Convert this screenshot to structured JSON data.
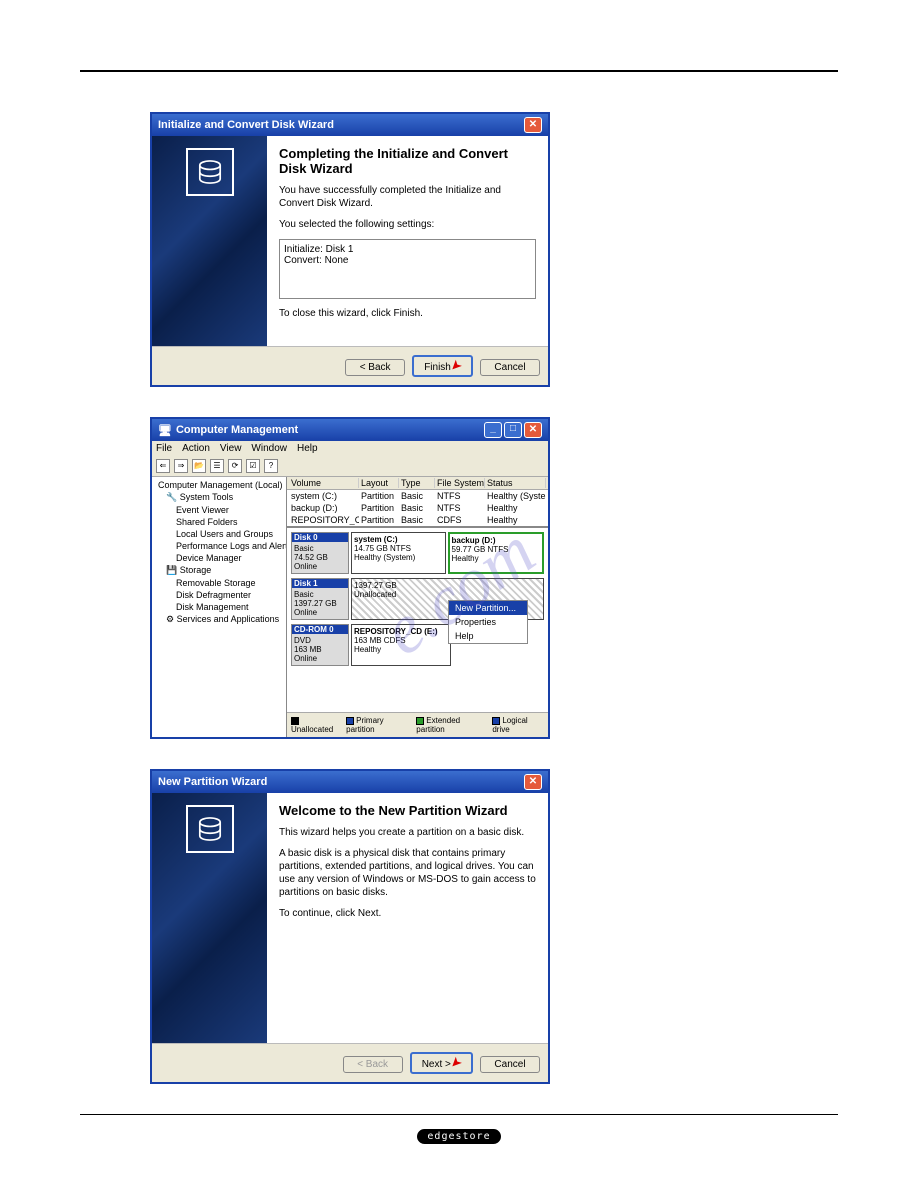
{
  "watermark": "e.com",
  "dialog1": {
    "title": "Initialize and Convert Disk Wizard",
    "heading": "Completing the Initialize and Convert Disk Wizard",
    "body1": "You have successfully completed the Initialize and Convert Disk Wizard.",
    "body2": "You selected the following settings:",
    "settings_line1": "Initialize: Disk 1",
    "settings_line2": "Convert: None",
    "body3": "To close this wizard, click Finish.",
    "buttons": {
      "back": "< Back",
      "finish": "Finish",
      "cancel": "Cancel"
    }
  },
  "cm": {
    "title": "Computer Management",
    "menu": [
      "File",
      "Action",
      "View",
      "Window",
      "Help"
    ],
    "tree_root": "Computer Management (Local)",
    "tree": {
      "system_tools": "System Tools",
      "event_viewer": "Event Viewer",
      "shared_folders": "Shared Folders",
      "local_users": "Local Users and Groups",
      "perf_logs": "Performance Logs and Alerts",
      "device_mgr": "Device Manager",
      "storage": "Storage",
      "removable": "Removable Storage",
      "defrag": "Disk Defragmenter",
      "diskmgmt": "Disk Management",
      "services": "Services and Applications"
    },
    "columns": [
      "Volume",
      "Layout",
      "Type",
      "File System",
      "Status"
    ],
    "rows": [
      {
        "vol": "system (C:)",
        "layout": "Partition",
        "type": "Basic",
        "fs": "NTFS",
        "status": "Healthy (System)"
      },
      {
        "vol": "backup (D:)",
        "layout": "Partition",
        "type": "Basic",
        "fs": "NTFS",
        "status": "Healthy"
      },
      {
        "vol": "REPOSITORY_CD (E:)",
        "layout": "Partition",
        "type": "Basic",
        "fs": "CDFS",
        "status": "Healthy"
      }
    ],
    "disks": {
      "disk0": {
        "name": "Disk 0",
        "kind": "Basic",
        "size": "74.52 GB",
        "state": "Online",
        "p1": {
          "name": "system  (C:)",
          "info": "14.75 GB NTFS",
          "status": "Healthy (System)"
        },
        "p2": {
          "name": "backup (D:)",
          "info": "59.77 GB NTFS",
          "status": "Healthy"
        }
      },
      "disk1": {
        "name": "Disk 1",
        "kind": "Basic",
        "size": "1397.27 GB",
        "state": "Online",
        "p1": {
          "name": "",
          "info": "1397.27 GB",
          "status": "Unallocated"
        }
      },
      "cdrom": {
        "name": "CD-ROM 0",
        "kind": "DVD",
        "size": "163 MB",
        "state": "Online",
        "p1": {
          "name": "REPOSITORY_CD (E:)",
          "info": "163 MB CDFS",
          "status": "Healthy"
        }
      }
    },
    "context": {
      "newpart": "New Partition...",
      "props": "Properties",
      "help": "Help"
    },
    "legend": {
      "unalloc": "Unallocated",
      "primary": "Primary partition",
      "extended": "Extended partition",
      "logical": "Logical drive"
    }
  },
  "dialog3": {
    "title": "New Partition Wizard",
    "heading": "Welcome to the New Partition Wizard",
    "body1": "This wizard helps you create a partition on a basic disk.",
    "body2": "A basic disk is a physical disk that contains primary partitions, extended partitions, and logical drives. You can use any version of Windows or MS-DOS to gain access to partitions on basic disks.",
    "body3": "To continue, click Next.",
    "buttons": {
      "back": "< Back",
      "next": "Next >",
      "cancel": "Cancel"
    }
  },
  "footer": "edgestore"
}
